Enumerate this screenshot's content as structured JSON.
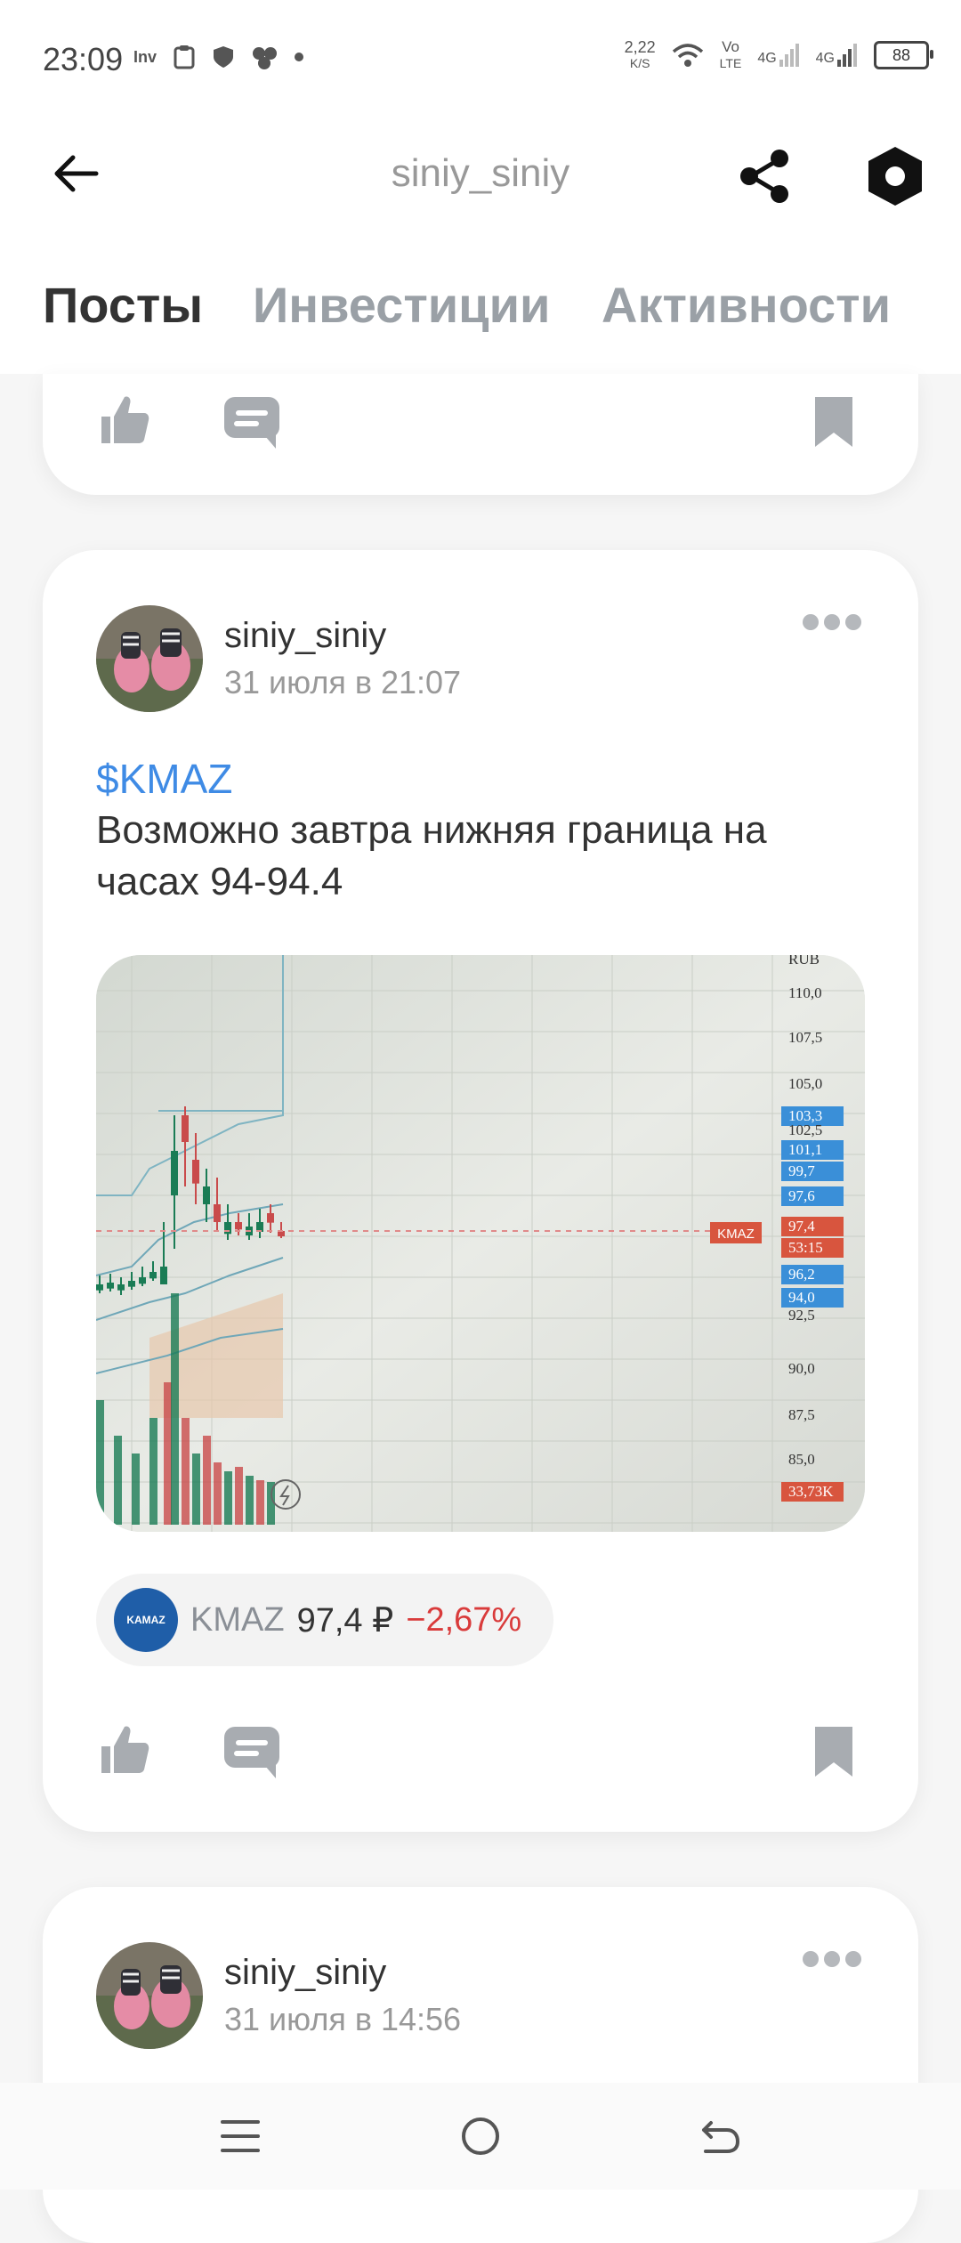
{
  "status_bar": {
    "time": "23:09",
    "net_speed_value": "2,22",
    "net_speed_unit": "K/S",
    "volte_top": "Vo",
    "volte_bottom": "LTE",
    "signal1_label": "4G",
    "signal2_label": "4G",
    "battery": "88",
    "icons": [
      "inv-icon",
      "clipboard-icon",
      "shield-icon",
      "app-dots-icon",
      "dot-icon",
      "wifi-icon",
      "signal-icon",
      "signal-icon",
      "battery-icon"
    ]
  },
  "appbar": {
    "title": "siniy_siniy",
    "icons": [
      "back-arrow-icon",
      "share-icon",
      "settings-hexagon-icon"
    ]
  },
  "tabs": [
    {
      "label": "Посты",
      "active": true
    },
    {
      "label": "Инвестиции",
      "active": false
    },
    {
      "label": "Активности",
      "active": false
    }
  ],
  "posts": [
    {
      "author": "siniy_siniy",
      "date": "31 июля в 21:07",
      "ticker_link": "$KMAZ",
      "text": "Возможно завтра нижняя граница на часах 94-94.4",
      "chart_image": {
        "axis_unit": "RUB",
        "price_ticks": [
          "110,0",
          "107,5",
          "105,0",
          "103,3",
          "102,5",
          "101,1",
          "99,7",
          "97,6",
          "97,4",
          "53:15",
          "96,2",
          "94,0",
          "92,5",
          "90,0",
          "87,5",
          "85,0",
          "33,73K"
        ],
        "price_tag": "KMAZ"
      },
      "ticker_chip": {
        "logo_text": "KAMAZ",
        "symbol": "KMAZ",
        "price": "97,4 ₽",
        "change": "−2,67%"
      }
    },
    {
      "author": "siniy_siniy",
      "date": "31 июля в 14:56"
    }
  ],
  "colors": {
    "accent_link": "#3f8be5",
    "negative": "#d93b3b",
    "icon_gray": "#9aa0a6"
  }
}
